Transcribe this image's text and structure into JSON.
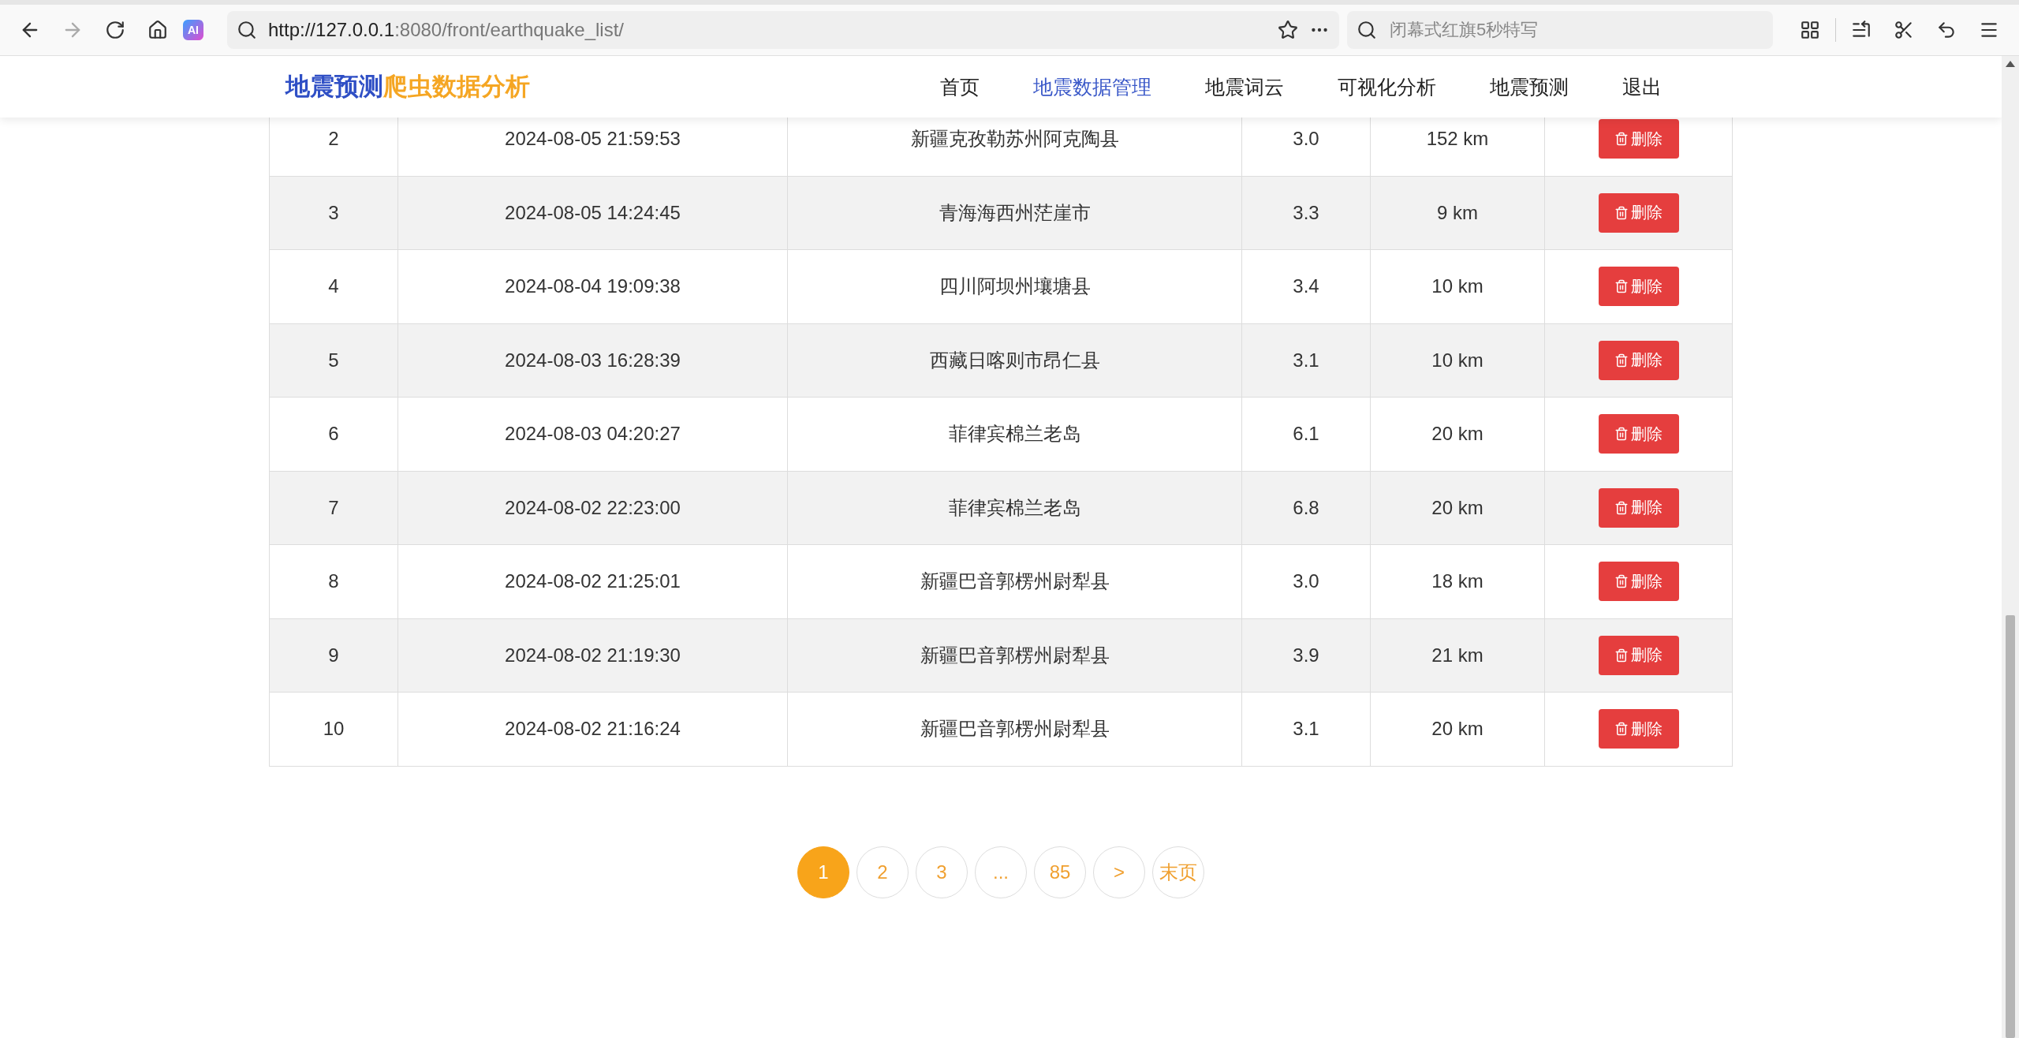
{
  "browser": {
    "url_host": "http://127.0.0.1",
    "url_rest": ":8080/front/earthquake_list/",
    "search_placeholder": "闭幕式红旗5秒特写",
    "ai_label": "AI"
  },
  "header": {
    "logo_part_1": "地震预测",
    "logo_part_2": "爬虫数据分析",
    "nav": [
      {
        "label": "首页",
        "selected": false
      },
      {
        "label": "地震数据管理",
        "selected": true
      },
      {
        "label": "地震词云",
        "selected": false
      },
      {
        "label": "可视化分析",
        "selected": false
      },
      {
        "label": "地震预测",
        "selected": false
      },
      {
        "label": "退出",
        "selected": false
      }
    ]
  },
  "table": {
    "rows": [
      {
        "id": "2",
        "time": "2024-08-05 21:59:53",
        "place": "新疆克孜勒苏州阿克陶县",
        "magnitude": "3.0",
        "depth": "152 km",
        "action": "删除"
      },
      {
        "id": "3",
        "time": "2024-08-05 14:24:45",
        "place": "青海海西州茫崖市",
        "magnitude": "3.3",
        "depth": "9 km",
        "action": "删除"
      },
      {
        "id": "4",
        "time": "2024-08-04 19:09:38",
        "place": "四川阿坝州壤塘县",
        "magnitude": "3.4",
        "depth": "10 km",
        "action": "删除"
      },
      {
        "id": "5",
        "time": "2024-08-03 16:28:39",
        "place": "西藏日喀则市昂仁县",
        "magnitude": "3.1",
        "depth": "10 km",
        "action": "删除"
      },
      {
        "id": "6",
        "time": "2024-08-03 04:20:27",
        "place": "菲律宾棉兰老岛",
        "magnitude": "6.1",
        "depth": "20 km",
        "action": "删除"
      },
      {
        "id": "7",
        "time": "2024-08-02 22:23:00",
        "place": "菲律宾棉兰老岛",
        "magnitude": "6.8",
        "depth": "20 km",
        "action": "删除"
      },
      {
        "id": "8",
        "time": "2024-08-02 21:25:01",
        "place": "新疆巴音郭楞州尉犁县",
        "magnitude": "3.0",
        "depth": "18 km",
        "action": "删除"
      },
      {
        "id": "9",
        "time": "2024-08-02 21:19:30",
        "place": "新疆巴音郭楞州尉犁县",
        "magnitude": "3.9",
        "depth": "21 km",
        "action": "删除"
      },
      {
        "id": "10",
        "time": "2024-08-02 21:16:24",
        "place": "新疆巴音郭楞州尉犁县",
        "magnitude": "3.1",
        "depth": "20 km",
        "action": "删除"
      }
    ]
  },
  "pagination": [
    {
      "label": "1",
      "selected": true
    },
    {
      "label": "2",
      "selected": false
    },
    {
      "label": "3",
      "selected": false
    },
    {
      "label": "...",
      "selected": false
    },
    {
      "label": "85",
      "selected": false
    },
    {
      "label": ">",
      "selected": false
    },
    {
      "label": "末页",
      "selected": false
    }
  ]
}
